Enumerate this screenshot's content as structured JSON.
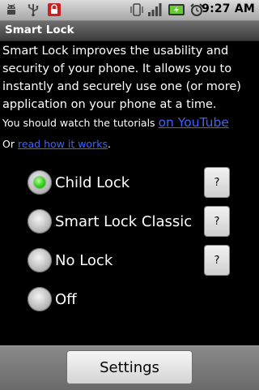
{
  "status_bar": {
    "icons_left": [
      "android-debug-icon",
      "usb-icon",
      "lock-notification-icon"
    ],
    "icons_right": [
      "vibrate-icon",
      "signal-icon",
      "battery-icon",
      "alarm-icon"
    ],
    "time": "9:27 AM"
  },
  "app": {
    "title": "Smart Lock"
  },
  "content": {
    "description": "Smart Lock improves the usability and security of your phone. It allows you to instantly and securely use one (or more) application on your phone at a time.",
    "tutorial_prefix": "You should watch the tutorials ",
    "tutorial_link": "on YouTube",
    "howto_prefix": "Or ",
    "howto_link": "read how it works",
    "howto_suffix": "."
  },
  "options": [
    {
      "label": "Child Lock",
      "selected": true,
      "help": "?"
    },
    {
      "label": "Smart Lock Classic",
      "selected": false,
      "help": "?"
    },
    {
      "label": "No Lock",
      "selected": false,
      "help": "?"
    },
    {
      "label": "Off",
      "selected": false
    }
  ],
  "footer": {
    "settings_label": "Settings"
  },
  "colors": {
    "link": "#3a63ff",
    "selected_radio": "#2fd11a",
    "alert_icon": "#cc1f1f",
    "battery": "#66cc33"
  }
}
